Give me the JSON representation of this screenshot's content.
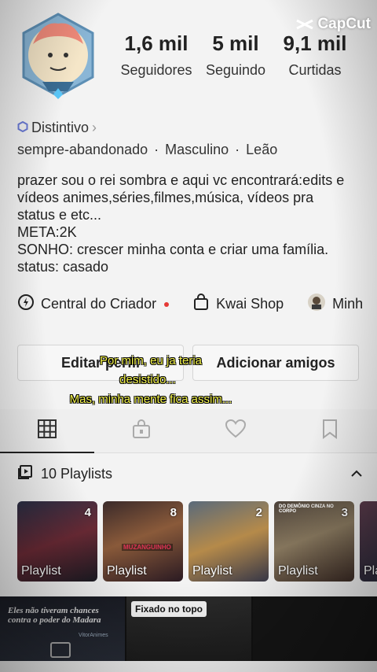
{
  "watermark": {
    "text": "CapCut",
    "icon": "capcut-logo-icon"
  },
  "profile": {
    "stats": [
      {
        "value": "1,6 mil",
        "label": "Seguidores"
      },
      {
        "value": "5 mil",
        "label": "Seguindo"
      },
      {
        "value": "9,1 mil",
        "label": "Curtidas"
      }
    ],
    "badge_label": "Distintivo",
    "info": [
      "sempre-abandonado",
      "·",
      "Masculino",
      "·",
      "Leão"
    ],
    "bio_lines": [
      "prazer sou o rei sombra e aqui vc encontrará:edits e",
      "vídeos animes,séries,filmes,música, vídeos pra",
      "status e etc...",
      "META:2K",
      "SONHO: crescer minha conta e criar uma família.",
      "status: casado"
    ]
  },
  "links": {
    "creator_center": "Central do Criador",
    "kwai_shop": "Kwai Shop",
    "third": "Minh"
  },
  "buttons": {
    "edit": "Editar perfil",
    "add_friends": "Adicionar amigos"
  },
  "subtitles": {
    "line1": "Por mim, eu ja teria",
    "line2": "desistido...",
    "line3": "Mas, minha mente fica assim..."
  },
  "tabs": [
    {
      "icon": "grid-icon",
      "active": true
    },
    {
      "icon": "lock-bag-icon",
      "active": false
    },
    {
      "icon": "heart-icon",
      "active": false
    },
    {
      "icon": "bookmark-icon",
      "active": false
    }
  ],
  "playlists": {
    "title": "10 Playlists",
    "items": [
      {
        "count": "4",
        "label": "Playlist"
      },
      {
        "count": "8",
        "label": "Playlist",
        "overlay": "MUZANGUINHO"
      },
      {
        "count": "2",
        "label": "Playlist"
      },
      {
        "count": "3",
        "label": "Playlist",
        "overlay": "DO DEMÔNIO CINZA NO CORPO"
      },
      {
        "count": "",
        "label": "Pla"
      }
    ]
  },
  "grid": {
    "cell1_text": "Eles não tiveram chances contra o poder do Madara",
    "cell1_sub": "VitorAnimes",
    "pinned": "Fixado no topo"
  },
  "colors": {
    "accent_red": "#e53935",
    "subtitle_yellow": "#f2f24a"
  }
}
